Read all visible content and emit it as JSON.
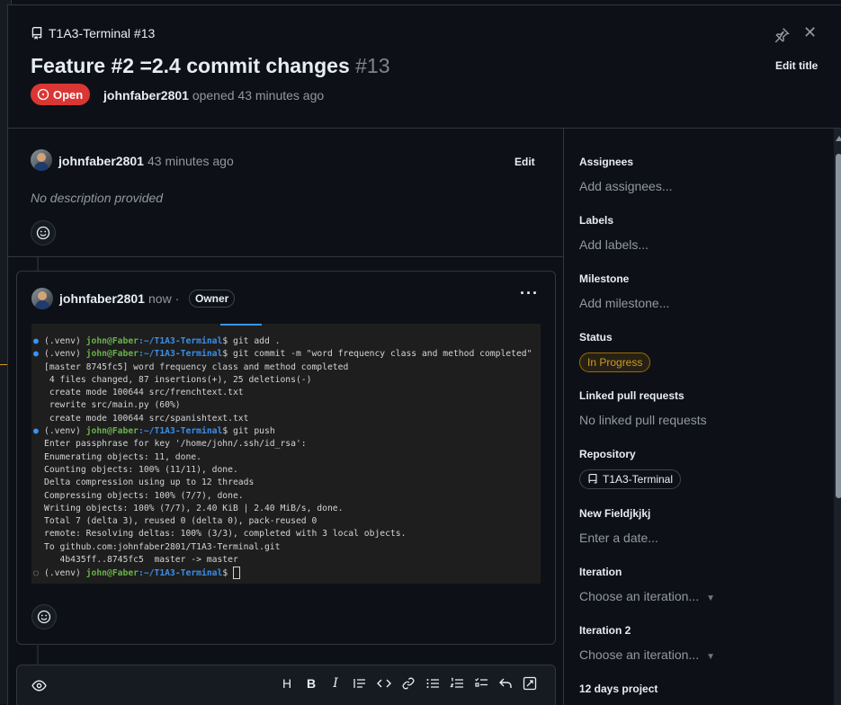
{
  "header": {
    "repo_ref": "T1A3-Terminal #13",
    "title": "Feature #2 =2.4 commit changes",
    "number": "#13",
    "edit_title": "Edit title",
    "state": "Open",
    "author": "johnfaber2801",
    "opened_text": "opened 43 minutes ago"
  },
  "comment1": {
    "author": "johnfaber2801",
    "time": "43 minutes ago",
    "edit": "Edit",
    "body": "No description provided"
  },
  "comment2": {
    "author": "johnfaber2801",
    "time": "now",
    "sep": "·",
    "role": "Owner",
    "menu": "···",
    "terminal": {
      "prompt_user": "john@Faber",
      "prompt_path": ":~/T1A3-Terminal",
      "lines": [
        {
          "kind": "cmd",
          "dot": "blue",
          "text": " git add ."
        },
        {
          "kind": "cmd",
          "dot": "blue",
          "text": " git commit -m \"word frequency class and method completed\""
        },
        {
          "kind": "out",
          "text": "[master 8745fc5] word frequency class and method completed"
        },
        {
          "kind": "out",
          "text": " 4 files changed, 87 insertions(+), 25 deletions(-)"
        },
        {
          "kind": "out",
          "text": " create mode 100644 src/frenchtext.txt"
        },
        {
          "kind": "out",
          "text": " rewrite src/main.py (60%)"
        },
        {
          "kind": "out",
          "text": " create mode 100644 src/spanishtext.txt"
        },
        {
          "kind": "cmd",
          "dot": "blue",
          "text": " git push"
        },
        {
          "kind": "out",
          "text": "Enter passphrase for key '/home/john/.ssh/id_rsa':"
        },
        {
          "kind": "out",
          "text": "Enumerating objects: 11, done."
        },
        {
          "kind": "out",
          "text": "Counting objects: 100% (11/11), done."
        },
        {
          "kind": "out",
          "text": "Delta compression using up to 12 threads"
        },
        {
          "kind": "out",
          "text": "Compressing objects: 100% (7/7), done."
        },
        {
          "kind": "out",
          "text": "Writing objects: 100% (7/7), 2.40 KiB | 2.40 MiB/s, done."
        },
        {
          "kind": "out",
          "text": "Total 7 (delta 3), reused 0 (delta 0), pack-reused 0"
        },
        {
          "kind": "out",
          "text": "remote: Resolving deltas: 100% (3/3), completed with 3 local objects."
        },
        {
          "kind": "out",
          "text": "To github.com:johnfaber2801/T1A3-Terminal.git"
        },
        {
          "kind": "out",
          "text": "   4b435ff..8745fc5  master -> master"
        },
        {
          "kind": "cmd",
          "dot": "grey",
          "text": " ",
          "cursor": true
        }
      ]
    }
  },
  "composer": {
    "preview_icon": "eye-icon",
    "tools": [
      "H",
      "B",
      "I",
      "quote-icon",
      "code-icon",
      "link-icon",
      "bulleted-list-icon",
      "numbered-list-icon",
      "task-list-icon",
      "undo-icon",
      "fullscreen-icon"
    ]
  },
  "sidebar": {
    "assignees": {
      "label": "Assignees",
      "value": "Add assignees..."
    },
    "labels": {
      "label": "Labels",
      "value": "Add labels..."
    },
    "milestone": {
      "label": "Milestone",
      "value": "Add milestone..."
    },
    "status": {
      "label": "Status",
      "value": "In Progress"
    },
    "linked_prs": {
      "label": "Linked pull requests",
      "value": "No linked pull requests"
    },
    "repository": {
      "label": "Repository",
      "value": "T1A3-Terminal"
    },
    "new_field": {
      "label": "New Fieldjkjkj",
      "value": "Enter a date..."
    },
    "iteration": {
      "label": "Iteration",
      "value": "Choose an iteration..."
    },
    "iteration2": {
      "label": "Iteration 2",
      "value": "Choose an iteration..."
    },
    "project12": {
      "label": "12 days project"
    }
  },
  "colors": {
    "open_badge": "#da3633",
    "status_yellow": "#d29922",
    "background": "#0d1117",
    "border": "#30363d"
  }
}
